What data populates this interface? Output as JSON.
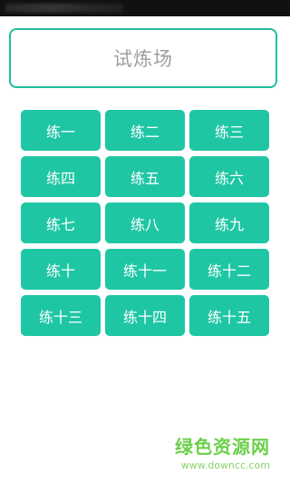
{
  "header": {
    "title": "试炼场"
  },
  "buttons": [
    {
      "label": "练一"
    },
    {
      "label": "练二"
    },
    {
      "label": "练三"
    },
    {
      "label": "练四"
    },
    {
      "label": "练五"
    },
    {
      "label": "练六"
    },
    {
      "label": "练七"
    },
    {
      "label": "练八"
    },
    {
      "label": "练九"
    },
    {
      "label": "练十"
    },
    {
      "label": "练十一"
    },
    {
      "label": "练十二"
    },
    {
      "label": "练十三"
    },
    {
      "label": "练十四"
    },
    {
      "label": "练十五"
    }
  ],
  "watermark": {
    "title": "绿色资源网",
    "url": "www.downcc.com"
  },
  "colors": {
    "accent": "#1fc6a4",
    "border": "#1fbf9d",
    "title_text": "#9e9e9e",
    "watermark": "#6ccf4a"
  }
}
